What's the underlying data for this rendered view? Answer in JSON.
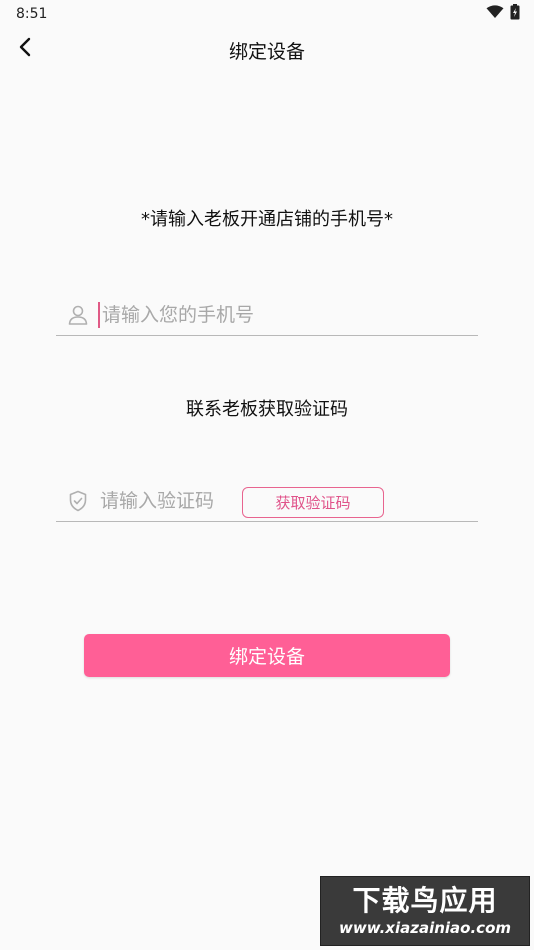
{
  "status_bar": {
    "time": "8:51",
    "wifi_icon": "wifi-icon",
    "battery_icon": "battery-charging-icon"
  },
  "app_bar": {
    "title": "绑定设备",
    "back_icon": "chevron-left-icon"
  },
  "form": {
    "instruction": "*请输入老板开通店铺的手机号*",
    "phone": {
      "icon": "user-icon",
      "placeholder": "请输入您的手机号",
      "value": ""
    },
    "contact_text": "联系老板获取验证码",
    "code": {
      "icon": "shield-check-icon",
      "placeholder": "请输入验证码",
      "value": "",
      "get_code_label": "获取验证码"
    },
    "submit_label": "绑定设备"
  },
  "colors": {
    "accent": "#ff5f96",
    "accent_border": "#e8648f",
    "background": "#fafafa"
  },
  "watermark": {
    "title": "下载鸟应用",
    "url": "www.xiazainiao.com"
  }
}
